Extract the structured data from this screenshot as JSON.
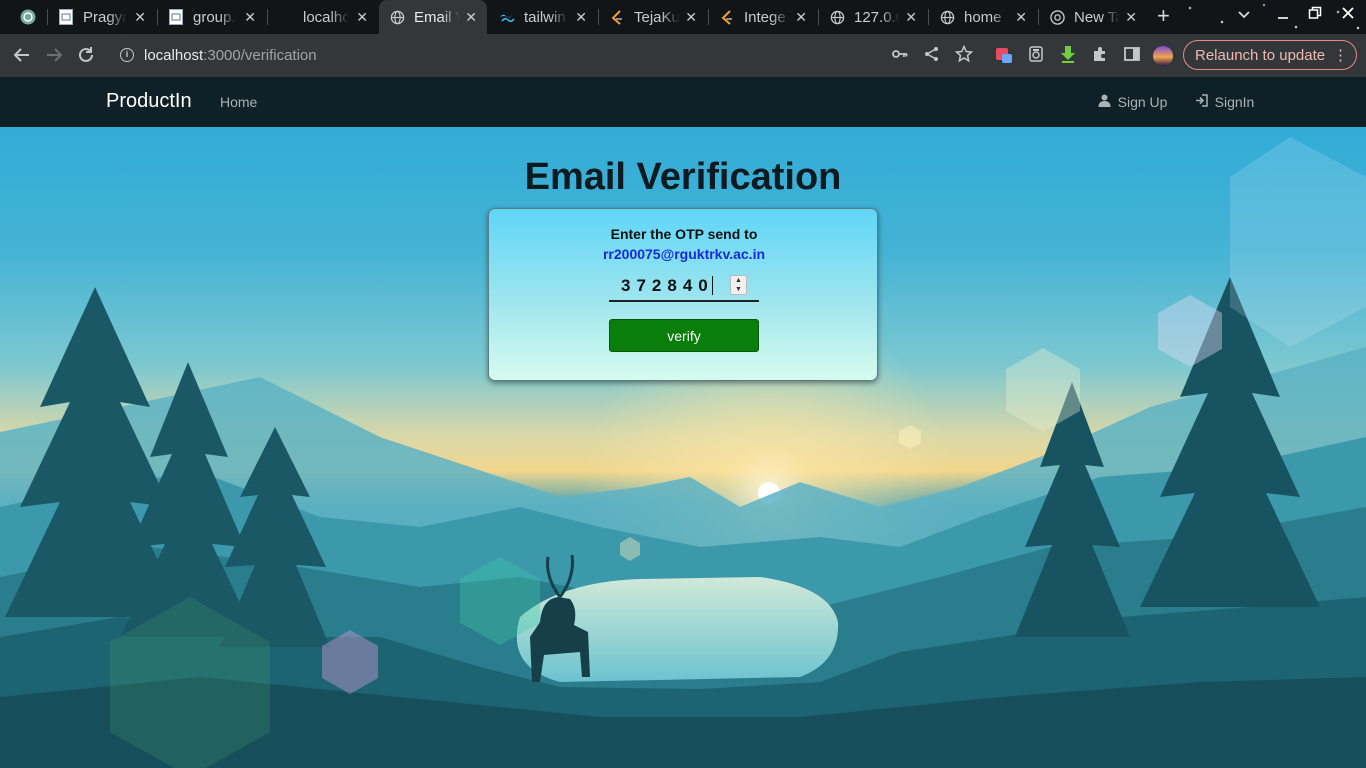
{
  "browser": {
    "tabs": [
      {
        "title": "",
        "icon": "chatgpt-icon"
      },
      {
        "title": "Pragya",
        "icon": "doc-icon"
      },
      {
        "title": "group.",
        "icon": "doc-icon"
      },
      {
        "title": "localho",
        "icon": "blank-icon"
      },
      {
        "title": "Email V",
        "icon": "globe-icon",
        "active": true
      },
      {
        "title": "tailwin",
        "icon": "tailwind-icon"
      },
      {
        "title": "TejaKu",
        "icon": "leetcode-icon"
      },
      {
        "title": "Intege",
        "icon": "leetcode-icon"
      },
      {
        "title": "127.0.0",
        "icon": "globe-icon"
      },
      {
        "title": "home",
        "icon": "globe-icon"
      },
      {
        "title": "New Ta",
        "icon": "chrome-icon"
      }
    ],
    "url_host": "localhost",
    "url_path": ":3000/verification",
    "relaunch_label": "Relaunch to update"
  },
  "navbar": {
    "brand": "ProductIn",
    "home": "Home",
    "signup": "Sign Up",
    "signin": "SignIn"
  },
  "main": {
    "heading": "Email Verification",
    "prompt": "Enter the OTP send to",
    "email": "rr200075@rguktrkv.ac.in",
    "otp_value": "372840",
    "verify_label": "verify"
  },
  "colors": {
    "navbar_bg": "#0f2026",
    "verify_button": "#0a7e0a",
    "email_text": "#1a2ad8"
  }
}
